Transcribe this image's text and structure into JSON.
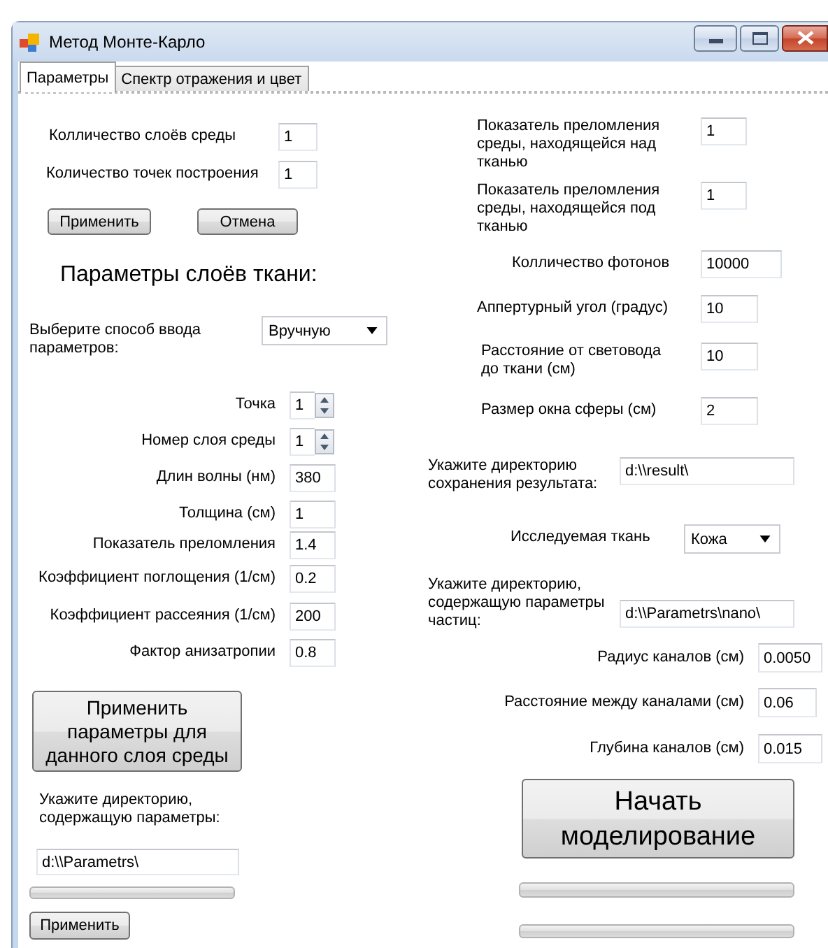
{
  "window": {
    "title": "Метод Монте-Карло"
  },
  "tabs": [
    {
      "label": "Параметры",
      "selected": true
    },
    {
      "label": "Спектр отражения и цвет",
      "selected": false
    }
  ],
  "left_panel": {
    "items": [
      {
        "kind": "field",
        "label": "Колличество слоёв среды",
        "value": "1"
      },
      {
        "kind": "field",
        "label": "Количество точек построения",
        "value": "1"
      },
      {
        "kind": "buttons",
        "labels": [
          "Применить",
          "Отмена"
        ]
      },
      {
        "kind": "heading",
        "text": "Параметры слоёв ткани:"
      },
      {
        "kind": "combo",
        "label": "Выберите способ ввода параметров:",
        "value": "Вручную"
      },
      {
        "kind": "spin",
        "label": "Точка",
        "value": "1"
      },
      {
        "kind": "spin",
        "label": "Номер слоя среды",
        "value": "1"
      },
      {
        "kind": "field",
        "label": "Длин волны (нм)",
        "value": "380"
      },
      {
        "kind": "field",
        "label": "Толщина (см)",
        "value": "1"
      },
      {
        "kind": "field",
        "label": "Показатель преломления",
        "value": "1.4"
      },
      {
        "kind": "field",
        "label": "Коэффициент поглощения (1/см)",
        "value": "0.2"
      },
      {
        "kind": "field",
        "label": "Коэффициент рассеяния (1/см)",
        "value": "200"
      },
      {
        "kind": "field",
        "label": "Фактор анизатропии",
        "value": "0.8"
      },
      {
        "kind": "button",
        "label": "Применить параметры для данного слоя среды"
      },
      {
        "kind": "note",
        "text": "Укажите директорию, содержащую параметры:"
      },
      {
        "kind": "input",
        "value": "d:\\\\Parametrs\\"
      },
      {
        "kind": "progress",
        "level": 0
      },
      {
        "kind": "button",
        "label": "Применить"
      }
    ]
  },
  "right_panel": {
    "items": [
      {
        "kind": "field",
        "label": "Показатель преломления среды, находящейся над тканью",
        "value": "1"
      },
      {
        "kind": "field",
        "label": "Показатель преломления среды, находящейся под тканью",
        "value": "1"
      },
      {
        "kind": "field",
        "label": "Колличество фотонов",
        "value": "10000"
      },
      {
        "kind": "field",
        "label": "Аппертурный угол (градус)",
        "value": "10"
      },
      {
        "kind": "field",
        "label": "Расстояние от световода до ткани (см)",
        "value": "10"
      },
      {
        "kind": "field",
        "label": "Размер окна сферы (см)",
        "value": "2"
      },
      {
        "kind": "field",
        "label": "Укажите директорию сохранения результата:",
        "value": "d:\\\\result\\"
      },
      {
        "kind": "combo",
        "label": "Исследуемая ткань",
        "value": "Кожа"
      },
      {
        "kind": "field",
        "label": "Укажите директорию, содержащую параметры частиц:",
        "value": "d:\\\\Parametrs\\nano\\"
      },
      {
        "kind": "field",
        "label": "Радиус каналов (см)",
        "value": "0.0050"
      },
      {
        "kind": "field",
        "label": "Расстояние между каналами (см)",
        "value": "0.06"
      },
      {
        "kind": "field",
        "label": "Глубина каналов (см)",
        "value": "0.015"
      },
      {
        "kind": "button",
        "label": "Начать моделирование"
      },
      {
        "kind": "progress",
        "level": 0
      },
      {
        "kind": "progress",
        "level": 0
      }
    ]
  }
}
